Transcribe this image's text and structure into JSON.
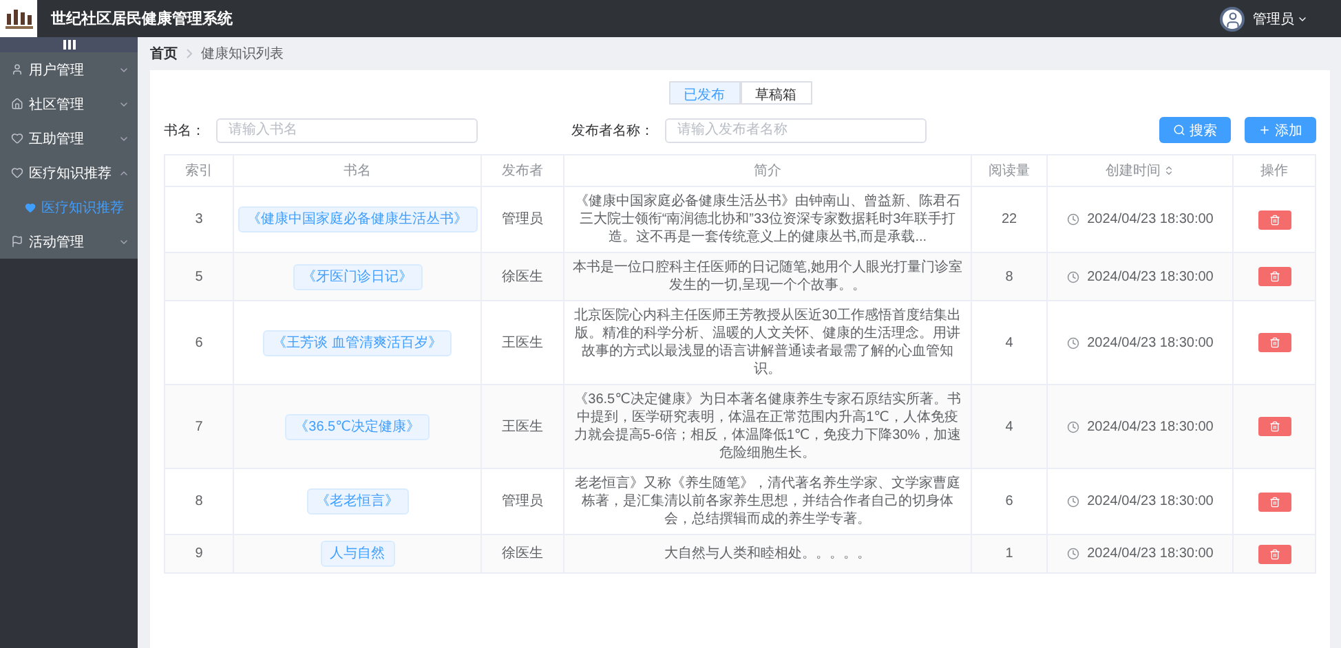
{
  "header": {
    "title": "世纪社区居民健康管理系统",
    "user": "管理员"
  },
  "sidebar": {
    "menu": [
      {
        "label": "用户管理",
        "expanded": false
      },
      {
        "label": "社区管理",
        "expanded": false
      },
      {
        "label": "互助管理",
        "expanded": false
      },
      {
        "label": "医疗知识推荐",
        "expanded": true,
        "children": [
          {
            "label": "医疗知识推荐",
            "selected": true
          }
        ]
      },
      {
        "label": "活动管理",
        "expanded": false
      }
    ]
  },
  "breadcrumb": [
    "首页",
    "健康知识列表"
  ],
  "tabs": [
    {
      "label": "已发布",
      "selected": true
    },
    {
      "label": "草稿箱",
      "selected": false
    }
  ],
  "filters": [
    {
      "label": "书名：",
      "placeholder": "请输入书名"
    },
    {
      "label": "发布者名称：",
      "placeholder": "请输入发布者名称"
    }
  ],
  "buttons": [
    {
      "label": "搜索",
      "kind": "search"
    },
    {
      "label": "添加",
      "kind": "add"
    }
  ],
  "table": {
    "columns": [
      {
        "label": "索引",
        "sortable": false
      },
      {
        "label": "书名",
        "sortable": false
      },
      {
        "label": "发布者",
        "sortable": false
      },
      {
        "label": "简介",
        "sortable": false
      },
      {
        "label": "阅读量",
        "sortable": false
      },
      {
        "label": "创建时间",
        "sortable": true
      },
      {
        "label": "操作",
        "sortable": false
      }
    ],
    "rows": [
      {
        "index": "3",
        "title": "《健康中国家庭必备健康生活丛书》",
        "publisher": "管理员",
        "summary": "《健康中国家庭必备健康生活丛书》由钟南山、曾益新、陈君石三大院士领衔“南润德北协和”33位资深专家数据耗时3年联手打造。这不再是一套传统意义上的健康丛书,而是承载...",
        "reads": "22",
        "created": "2024/04/23 18:30:00"
      },
      {
        "index": "5",
        "title": "《牙医门诊日记》",
        "publisher": "徐医生",
        "summary": "本书是一位口腔科主任医师的日记随笔,她用个人眼光打量门诊室发生的一切,呈现一个个故事。。",
        "reads": "8",
        "created": "2024/04/23 18:30:00"
      },
      {
        "index": "6",
        "title": "《王芳谈 血管清爽活百岁》",
        "publisher": "王医生",
        "summary": "北京医院心内科主任医师王芳教授从医近30工作感悟首度结集出版。精准的科学分析、温暖的人文关怀、健康的生活理念。用讲故事的方式以最浅显的语言讲解普通读者最需了解的心血管知识。",
        "reads": "4",
        "created": "2024/04/23 18:30:00"
      },
      {
        "index": "7",
        "title": "《36.5℃决定健康》",
        "publisher": "王医生",
        "summary": "《36.5℃决定健康》为日本著名健康养生专家石原结实所著。书中提到，医学研究表明，体温在正常范围内升高1℃，人体免疫力就会提高5-6倍；相反，体温降低1℃，免疫力下降30%，加速危险细胞生长。",
        "reads": "4",
        "created": "2024/04/23 18:30:00"
      },
      {
        "index": "8",
        "title": "《老老恒言》",
        "publisher": "管理员",
        "summary": "老老恒言》又称《养生随笔》，清代著名养生学家、文学家曹庭栋著，是汇集清以前各家养生思想，并结合作者自己的切身体会，总结撰辑而成的养生学专著。",
        "reads": "6",
        "created": "2024/04/23 18:30:00"
      },
      {
        "index": "9",
        "title": "人与自然",
        "publisher": "徐医生",
        "summary": "大自然与人类和睦相处。。。。。",
        "reads": "1",
        "created": "2024/04/23 18:30:00"
      }
    ]
  }
}
